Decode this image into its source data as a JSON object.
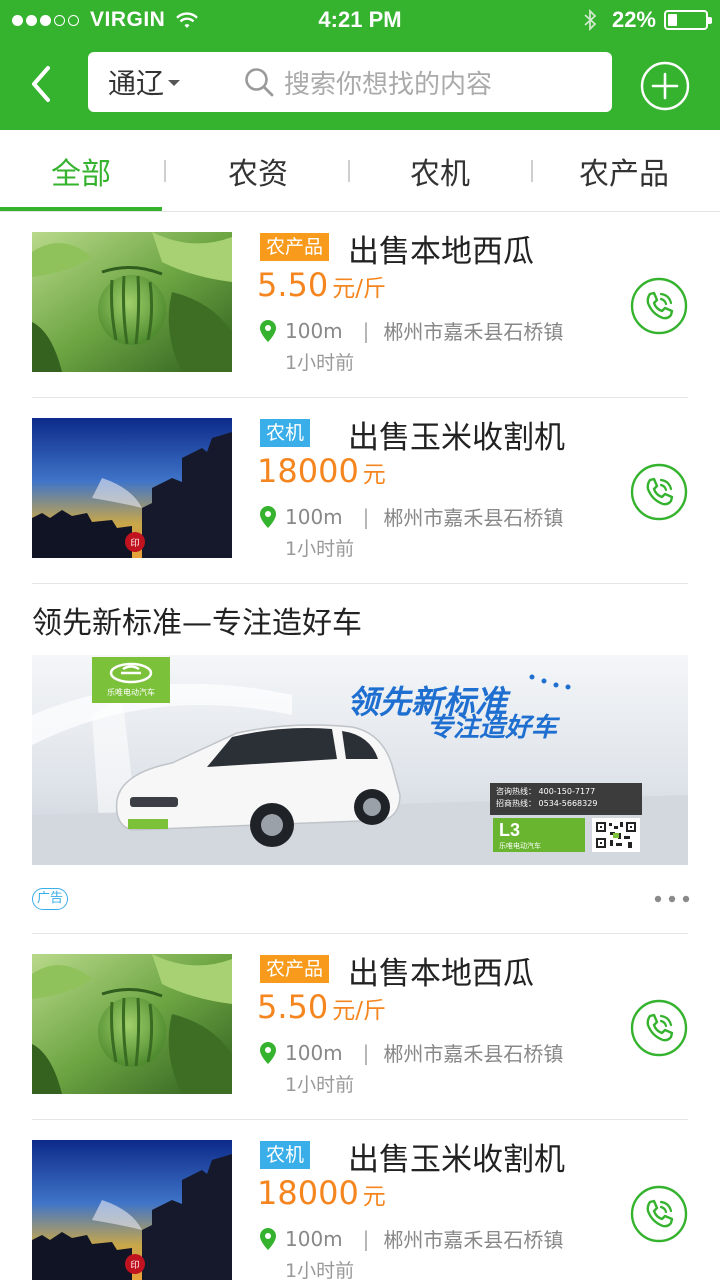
{
  "status_bar": {
    "carrier": "VIRGIN",
    "time": "4:21 PM",
    "battery_pct": "22%",
    "battery_level": 0.22,
    "signal_bars_filled": 3,
    "signal_bars_total": 5,
    "icons": [
      "signal-dots-icon",
      "wifi-icon",
      "bluetooth-icon",
      "battery-icon"
    ]
  },
  "nav": {
    "back_icon": "chevron-left-icon",
    "region": "通辽",
    "search_placeholder": "搜索你想找的内容",
    "add_icon": "plus-circle-icon"
  },
  "tabs": [
    {
      "label": "全部",
      "active": true
    },
    {
      "label": "农资",
      "active": false
    },
    {
      "label": "农机",
      "active": false
    },
    {
      "label": "农产品",
      "active": false
    }
  ],
  "colors": {
    "brand_green": "#35b22e",
    "price_orange": "#f5861f",
    "tag_orange": "#f89a1c",
    "tag_blue": "#3aaee8"
  },
  "items": [
    {
      "tag": "农产品",
      "tag_color": "orange",
      "title": "出售本地西瓜",
      "price": "5.50",
      "unit": "元/斤",
      "distance": "100m",
      "location": "郴州市嘉禾县石桥镇",
      "time_ago": "1小时前",
      "image": "watermelon-photo"
    },
    {
      "tag": "农机",
      "tag_color": "blue",
      "title": "出售玉米收割机",
      "price": "18000",
      "unit": "元",
      "distance": "100m",
      "location": "郴州市嘉禾县石桥镇",
      "time_ago": "1小时前",
      "image": "sunset-skyline-photo"
    },
    {
      "tag": "农产品",
      "tag_color": "orange",
      "title": "出售本地西瓜",
      "price": "5.50",
      "unit": "元/斤",
      "distance": "100m",
      "location": "郴州市嘉禾县石桥镇",
      "time_ago": "1小时前",
      "image": "watermelon-photo"
    },
    {
      "tag": "农机",
      "tag_color": "blue",
      "title": "出售玉米收割机",
      "price": "18000",
      "unit": "元",
      "distance": "100m",
      "location": "郴州市嘉禾县石桥镇",
      "time_ago": "1小时前",
      "image": "sunset-skyline-photo"
    }
  ],
  "ad": {
    "title": "领先新标准—专注造好车",
    "slogan_line1": "领先新标准",
    "slogan_line2": "专注造好车",
    "brand": "乐唯电动汽车",
    "hotline_consult": "咨询热线： 400-150-7177",
    "hotline_business": "招商热线： 0534-5668329",
    "model": "L3",
    "badge": "广告",
    "more_icon": "more-dots-icon"
  }
}
